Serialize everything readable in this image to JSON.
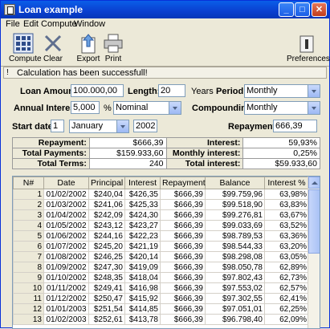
{
  "window": {
    "title": "Loan example"
  },
  "menu": [
    "File",
    "Edit",
    "Compute",
    "Window"
  ],
  "toolbar": {
    "compute": "Compute",
    "clear": "Clear",
    "export": "Export",
    "print": "Print",
    "preferences": "Preferences"
  },
  "status": {
    "message": "Calculation has been successfull!"
  },
  "form": {
    "loan_amount_label": "Loan Amount:",
    "loan_amount": "100.000,00",
    "length_label": "Length:",
    "length": "20",
    "length_unit": "Years",
    "period_label": "Period:",
    "period": "Monthly",
    "annual_interest_label": "Annual Interest:",
    "annual_interest": "5,000",
    "interest_unit": "%",
    "interest_type": "Nominal",
    "compounding_label": "Compounding:",
    "compounding": "Monthly",
    "start_date_label": "Start date:",
    "start_day": "1",
    "start_month": "January",
    "start_year": "2002",
    "repayment_label": "Repayment:",
    "repayment": "666,39"
  },
  "summary": [
    [
      "Repayment:",
      "$666,39",
      "Interest:",
      "59,93%"
    ],
    [
      "Total Payments:",
      "$159.933,60",
      "Monthly interest:",
      "0,25%"
    ],
    [
      "Total Terms:",
      "240",
      "Total interest:",
      "$59.933,60"
    ]
  ],
  "schedule": {
    "headers": [
      "N#",
      "Date",
      "Principal",
      "Interest",
      "Repayment",
      "Balance",
      "Interest %"
    ],
    "rows": [
      [
        "1",
        "01/02/2002",
        "$240,04",
        "$426,35",
        "$666,39",
        "$99.759,96",
        "63,98%"
      ],
      [
        "2",
        "01/03/2002",
        "$241,06",
        "$425,33",
        "$666,39",
        "$99.518,90",
        "63,83%"
      ],
      [
        "3",
        "01/04/2002",
        "$242,09",
        "$424,30",
        "$666,39",
        "$99.276,81",
        "63,67%"
      ],
      [
        "4",
        "01/05/2002",
        "$243,12",
        "$423,27",
        "$666,39",
        "$99.033,69",
        "63,52%"
      ],
      [
        "5",
        "01/06/2002",
        "$244,16",
        "$422,23",
        "$666,39",
        "$98.789,53",
        "63,36%"
      ],
      [
        "6",
        "01/07/2002",
        "$245,20",
        "$421,19",
        "$666,39",
        "$98.544,33",
        "63,20%"
      ],
      [
        "7",
        "01/08/2002",
        "$246,25",
        "$420,14",
        "$666,39",
        "$98.298,08",
        "63,05%"
      ],
      [
        "8",
        "01/09/2002",
        "$247,30",
        "$419,09",
        "$666,39",
        "$98.050,78",
        "62,89%"
      ],
      [
        "9",
        "01/10/2002",
        "$248,35",
        "$418,04",
        "$666,39",
        "$97.802,43",
        "62,73%"
      ],
      [
        "10",
        "01/11/2002",
        "$249,41",
        "$416,98",
        "$666,39",
        "$97.553,02",
        "62,57%"
      ],
      [
        "11",
        "01/12/2002",
        "$250,47",
        "$415,92",
        "$666,39",
        "$97.302,55",
        "62,41%"
      ],
      [
        "12",
        "01/01/2003",
        "$251,54",
        "$414,85",
        "$666,39",
        "$97.051,01",
        "62,25%"
      ],
      [
        "13",
        "01/02/2003",
        "$252,61",
        "$413,78",
        "$666,39",
        "$96.798,40",
        "62,09%"
      ]
    ]
  }
}
